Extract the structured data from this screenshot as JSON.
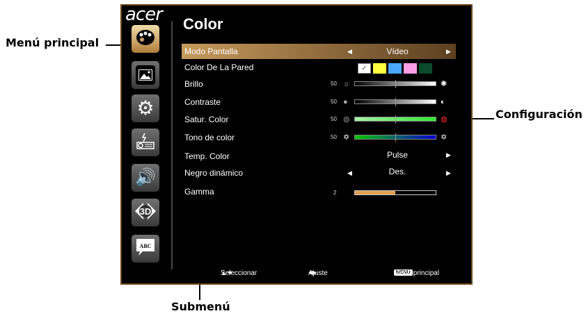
{
  "callouts": {
    "main_menu": "Menú principal",
    "settings": "Configuración",
    "submenu": "Submenú"
  },
  "osd": {
    "logo": "acer",
    "title": "Color",
    "side_menu_icons": [
      "palette-icon",
      "picture-icon",
      "gear-icon",
      "projector-icon",
      "speaker-icon",
      "3d-icon",
      "abc-speech-icon"
    ],
    "rows": {
      "display_mode": {
        "label": "Modo Pantalla",
        "value": "Vídeo"
      },
      "wall_color": {
        "label": "Color De La Pared",
        "swatches": [
          "#ffffff",
          "#ffff40",
          "#4aa8ff",
          "#ff9ee8",
          "#0a4a2a"
        ]
      },
      "brightness": {
        "label": "Brillo",
        "value": "50",
        "level": 50
      },
      "contrast": {
        "label": "Contraste",
        "value": "50",
        "level": 50
      },
      "saturation": {
        "label": "Satur. Color",
        "value": "50",
        "level": 50
      },
      "tint": {
        "label": "Tono de color",
        "value": "50",
        "level": 50
      },
      "color_temp": {
        "label": "Temp. Color",
        "value": "Pulse"
      },
      "dynamic_black": {
        "label": "Negro dinámico",
        "value": "Des."
      },
      "gamma": {
        "label": "Gamma",
        "value": "2",
        "level": 0.5
      }
    },
    "footer": {
      "select": "Seleccionar",
      "adjust": "Ajuste",
      "menu_key": "MENU",
      "main_menu": "Menú principal"
    }
  },
  "colors": {
    "accent": "#c69a5c",
    "border": "#6e4a1c",
    "saturation_bar": "#2ee82e",
    "tint_bar_left": "#00c800",
    "tint_bar_right": "#0000d0",
    "gamma_bar": "#e0a050"
  }
}
